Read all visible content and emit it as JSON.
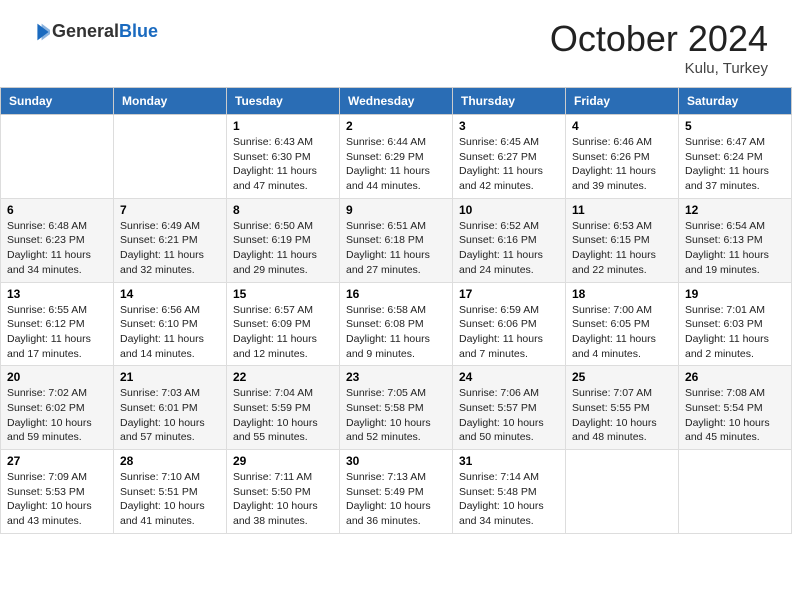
{
  "header": {
    "logo": {
      "general": "General",
      "blue": "Blue"
    },
    "title": "October 2024",
    "location": "Kulu, Turkey"
  },
  "weekdays": [
    "Sunday",
    "Monday",
    "Tuesday",
    "Wednesday",
    "Thursday",
    "Friday",
    "Saturday"
  ],
  "weeks": [
    [
      null,
      null,
      {
        "day": 1,
        "sunrise": "6:43 AM",
        "sunset": "6:30 PM",
        "daylight": "11 hours and 47 minutes."
      },
      {
        "day": 2,
        "sunrise": "6:44 AM",
        "sunset": "6:29 PM",
        "daylight": "11 hours and 44 minutes."
      },
      {
        "day": 3,
        "sunrise": "6:45 AM",
        "sunset": "6:27 PM",
        "daylight": "11 hours and 42 minutes."
      },
      {
        "day": 4,
        "sunrise": "6:46 AM",
        "sunset": "6:26 PM",
        "daylight": "11 hours and 39 minutes."
      },
      {
        "day": 5,
        "sunrise": "6:47 AM",
        "sunset": "6:24 PM",
        "daylight": "11 hours and 37 minutes."
      }
    ],
    [
      {
        "day": 6,
        "sunrise": "6:48 AM",
        "sunset": "6:23 PM",
        "daylight": "11 hours and 34 minutes."
      },
      {
        "day": 7,
        "sunrise": "6:49 AM",
        "sunset": "6:21 PM",
        "daylight": "11 hours and 32 minutes."
      },
      {
        "day": 8,
        "sunrise": "6:50 AM",
        "sunset": "6:19 PM",
        "daylight": "11 hours and 29 minutes."
      },
      {
        "day": 9,
        "sunrise": "6:51 AM",
        "sunset": "6:18 PM",
        "daylight": "11 hours and 27 minutes."
      },
      {
        "day": 10,
        "sunrise": "6:52 AM",
        "sunset": "6:16 PM",
        "daylight": "11 hours and 24 minutes."
      },
      {
        "day": 11,
        "sunrise": "6:53 AM",
        "sunset": "6:15 PM",
        "daylight": "11 hours and 22 minutes."
      },
      {
        "day": 12,
        "sunrise": "6:54 AM",
        "sunset": "6:13 PM",
        "daylight": "11 hours and 19 minutes."
      }
    ],
    [
      {
        "day": 13,
        "sunrise": "6:55 AM",
        "sunset": "6:12 PM",
        "daylight": "11 hours and 17 minutes."
      },
      {
        "day": 14,
        "sunrise": "6:56 AM",
        "sunset": "6:10 PM",
        "daylight": "11 hours and 14 minutes."
      },
      {
        "day": 15,
        "sunrise": "6:57 AM",
        "sunset": "6:09 PM",
        "daylight": "11 hours and 12 minutes."
      },
      {
        "day": 16,
        "sunrise": "6:58 AM",
        "sunset": "6:08 PM",
        "daylight": "11 hours and 9 minutes."
      },
      {
        "day": 17,
        "sunrise": "6:59 AM",
        "sunset": "6:06 PM",
        "daylight": "11 hours and 7 minutes."
      },
      {
        "day": 18,
        "sunrise": "7:00 AM",
        "sunset": "6:05 PM",
        "daylight": "11 hours and 4 minutes."
      },
      {
        "day": 19,
        "sunrise": "7:01 AM",
        "sunset": "6:03 PM",
        "daylight": "11 hours and 2 minutes."
      }
    ],
    [
      {
        "day": 20,
        "sunrise": "7:02 AM",
        "sunset": "6:02 PM",
        "daylight": "10 hours and 59 minutes."
      },
      {
        "day": 21,
        "sunrise": "7:03 AM",
        "sunset": "6:01 PM",
        "daylight": "10 hours and 57 minutes."
      },
      {
        "day": 22,
        "sunrise": "7:04 AM",
        "sunset": "5:59 PM",
        "daylight": "10 hours and 55 minutes."
      },
      {
        "day": 23,
        "sunrise": "7:05 AM",
        "sunset": "5:58 PM",
        "daylight": "10 hours and 52 minutes."
      },
      {
        "day": 24,
        "sunrise": "7:06 AM",
        "sunset": "5:57 PM",
        "daylight": "10 hours and 50 minutes."
      },
      {
        "day": 25,
        "sunrise": "7:07 AM",
        "sunset": "5:55 PM",
        "daylight": "10 hours and 48 minutes."
      },
      {
        "day": 26,
        "sunrise": "7:08 AM",
        "sunset": "5:54 PM",
        "daylight": "10 hours and 45 minutes."
      }
    ],
    [
      {
        "day": 27,
        "sunrise": "7:09 AM",
        "sunset": "5:53 PM",
        "daylight": "10 hours and 43 minutes."
      },
      {
        "day": 28,
        "sunrise": "7:10 AM",
        "sunset": "5:51 PM",
        "daylight": "10 hours and 41 minutes."
      },
      {
        "day": 29,
        "sunrise": "7:11 AM",
        "sunset": "5:50 PM",
        "daylight": "10 hours and 38 minutes."
      },
      {
        "day": 30,
        "sunrise": "7:13 AM",
        "sunset": "5:49 PM",
        "daylight": "10 hours and 36 minutes."
      },
      {
        "day": 31,
        "sunrise": "7:14 AM",
        "sunset": "5:48 PM",
        "daylight": "10 hours and 34 minutes."
      },
      null,
      null
    ]
  ],
  "labels": {
    "sunrise": "Sunrise:",
    "sunset": "Sunset:",
    "daylight": "Daylight:"
  }
}
